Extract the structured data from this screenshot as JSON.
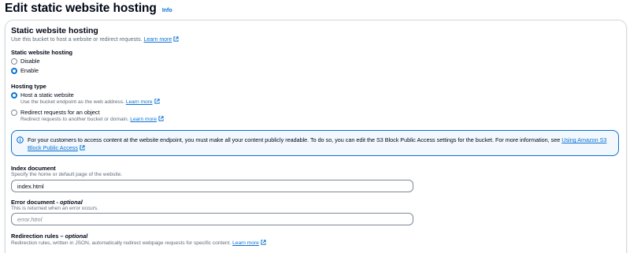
{
  "header": {
    "title": "Edit static website hosting",
    "info_label": "Info"
  },
  "panel": {
    "title": "Static website hosting",
    "description": "Use this bucket to host a website or redirect requests.",
    "learn_more": "Learn more"
  },
  "hosting_toggle": {
    "label": "Static website hosting",
    "options": [
      {
        "label": "Disable",
        "selected": false
      },
      {
        "label": "Enable",
        "selected": true
      }
    ]
  },
  "hosting_type": {
    "label": "Hosting type",
    "options": [
      {
        "label": "Host a static website",
        "description": "Use the bucket endpoint as the web address.",
        "learn_more": "Learn more",
        "selected": true
      },
      {
        "label": "Redirect requests for an object",
        "description": "Redirect requests to another bucket or domain.",
        "learn_more": "Learn more",
        "selected": false
      }
    ]
  },
  "alert": {
    "text": "For your customers to access content at the website endpoint, you must make all your content publicly readable. To do so, you can edit the S3 Block Public Access settings for the bucket. For more information, see",
    "link": "Using Amazon S3 Block Public Access"
  },
  "index_document": {
    "label": "Index document",
    "description": "Specify the home or default page of the website.",
    "value": "index.html"
  },
  "error_document": {
    "label": "Error document",
    "label_suffix": "optional",
    "description": "This is returned when an error occurs.",
    "placeholder": "error.html",
    "value": ""
  },
  "redirection_rules": {
    "label": "Redirection rules",
    "label_suffix": "optional",
    "description": "Redirection rules, written in JSON, automatically redirect webpage requests for specific content.",
    "learn_more": "Learn more"
  },
  "colors": {
    "link": "#0972d3",
    "alert_bg": "#f2f8fd",
    "text": "#000716",
    "muted": "#5f6b7a"
  }
}
